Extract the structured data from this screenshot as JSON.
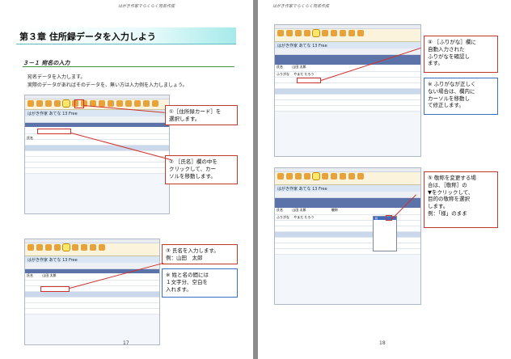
{
  "header_text": "はがき作家でらくらく宛名作成",
  "left_page": {
    "chapter_title": "第３章 住所録データを入力しよう",
    "section_title": "３－１ 宛名の入力",
    "body_lines": [
      "宛名データを入力します。",
      "実際のデータがあればそのデータを、無い方は入力例を入力しましょう。"
    ],
    "callouts": [
      {
        "id": "1",
        "lines": [
          "①［住所録カード］を",
          "選択します。"
        ]
      },
      {
        "id": "2",
        "lines": [
          "② ［氏名］欄の中を",
          "クリックして、カー",
          "ソルを移動します。"
        ]
      },
      {
        "id": "3",
        "lines": [
          "③ 氏名を入力します。",
          "例：山田　太郎"
        ]
      }
    ],
    "note": {
      "lines": [
        "※ 姓と名の間には",
        "１文字分、空白を",
        "入れます。"
      ]
    },
    "page_number": "17"
  },
  "right_page": {
    "callouts": [
      {
        "id": "4",
        "lines": [
          "④ ［ふりがな］欄に",
          "自動入力された",
          "ふりがなを確認し",
          "ます。"
        ]
      },
      {
        "id": "5",
        "lines": [
          "⑤ 敬称を変更する場",
          "合は、［敬称］の",
          "▼をクリックして、",
          "目的の敬称を選択",
          "します。",
          "例：「様」のまま"
        ]
      }
    ],
    "note": {
      "lines": [
        "※ ふりがなが正しく",
        "ない場合は、欄内に",
        "カーソルを移動し",
        "て修正します。"
      ]
    },
    "page_number": "18"
  },
  "screenshot_texts": {
    "app_title": "はがき作家 あてな 13 Free",
    "name_label": "氏名",
    "name_value": "山田 太郎",
    "kana_label": "ふりがな",
    "kana_value": "やまだ たろう",
    "honorific_label": "敬称",
    "honorific_value": "様"
  }
}
